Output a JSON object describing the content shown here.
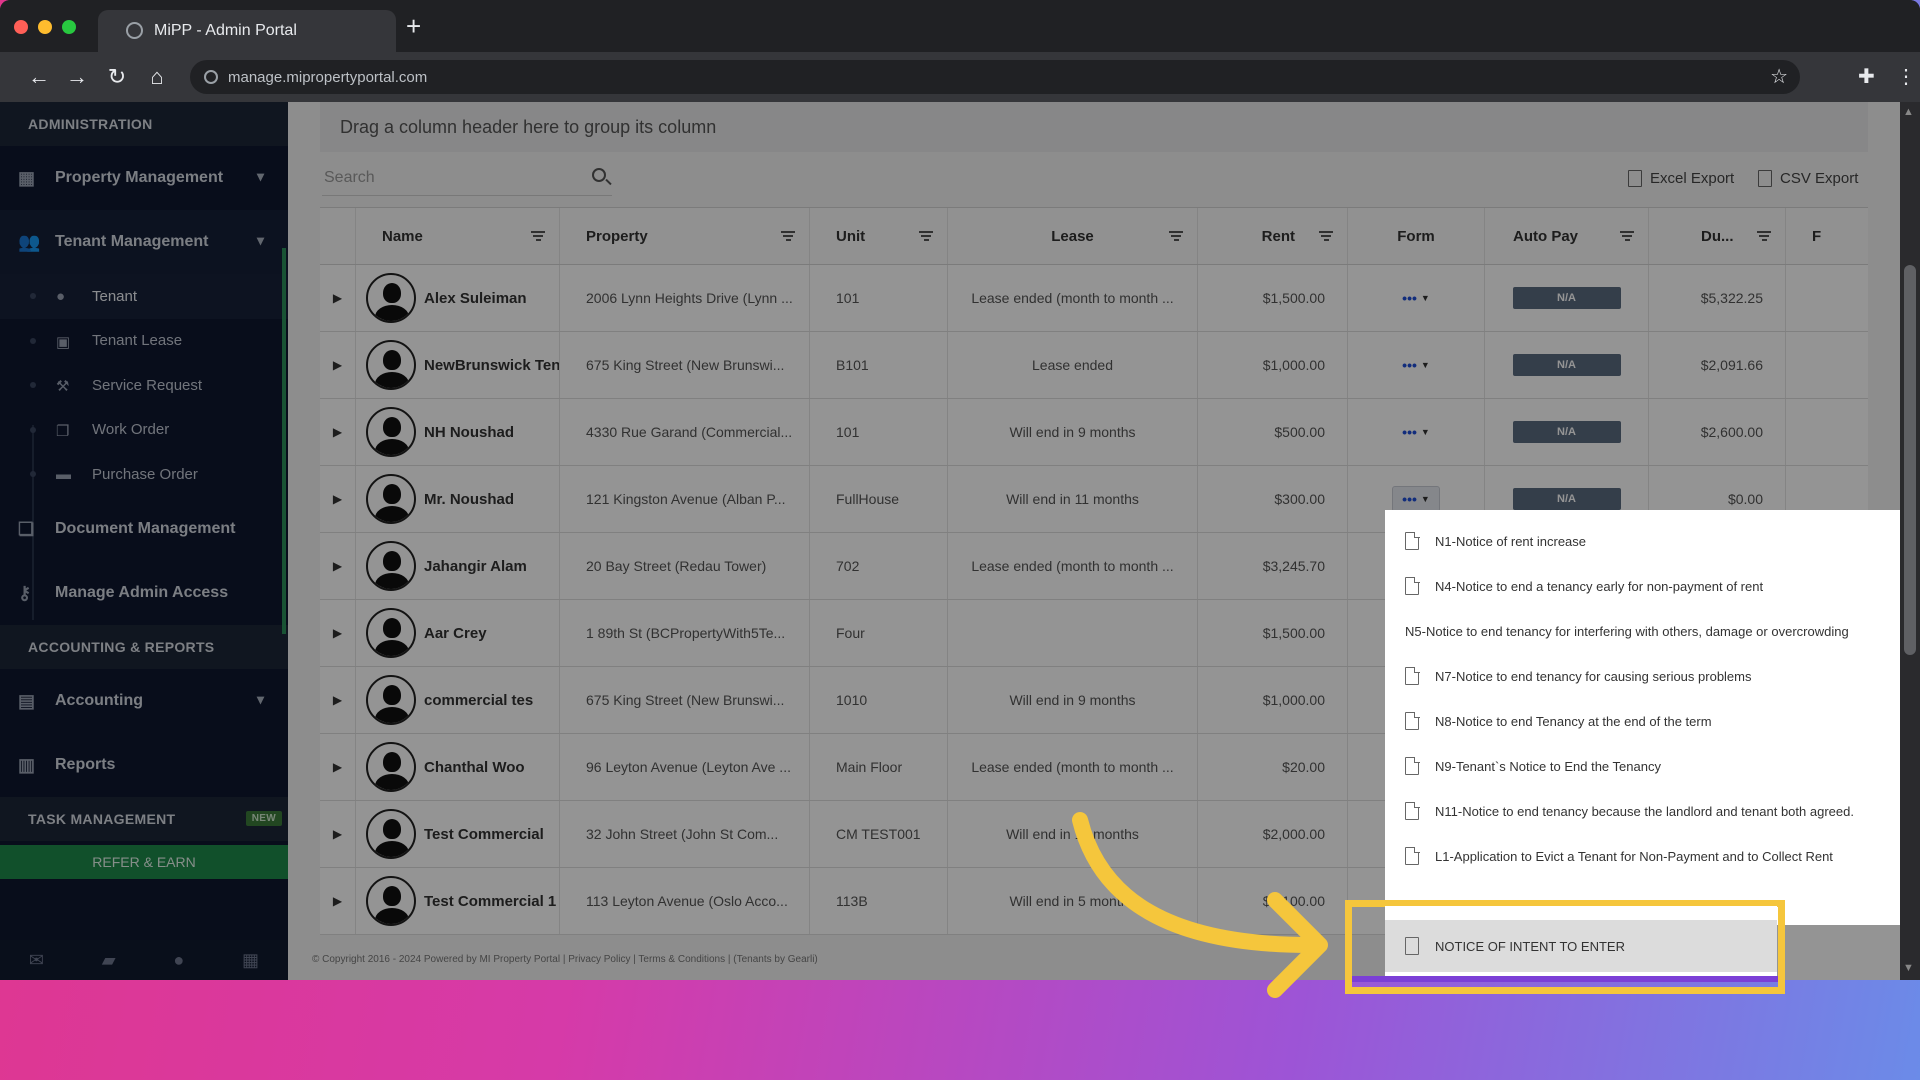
{
  "browser": {
    "tab_title": "MiPP - Admin Portal",
    "new_tab": "+",
    "url": "manage.mipropertyportal.com"
  },
  "sidebar": {
    "section_admin": "ADMINISTRATION",
    "property_management": "Property Management",
    "tenant_management": "Tenant Management",
    "sub_items": [
      {
        "label": "Tenant",
        "icon": "user-icon"
      },
      {
        "label": "Tenant Lease",
        "icon": "calendar-icon"
      },
      {
        "label": "Service Request",
        "icon": "wrench-icon"
      },
      {
        "label": "Work Order",
        "icon": "copy-icon"
      },
      {
        "label": "Purchase Order",
        "icon": "truck-icon"
      }
    ],
    "document_management": "Document Management",
    "manage_admin_access": "Manage Admin Access",
    "section_accounting": "ACCOUNTING & REPORTS",
    "accounting": "Accounting",
    "reports": "Reports",
    "section_task": "TASK MANAGEMENT",
    "new_badge": "NEW",
    "refer": "REFER & EARN"
  },
  "main": {
    "group_hint": "Drag a column header here to group its column",
    "search_placeholder": "Search",
    "excel_export": "Excel Export",
    "csv_export": "CSV Export",
    "columns": [
      "Name",
      "Property",
      "Unit",
      "Lease",
      "Rent",
      "Form",
      "Auto Pay",
      "Du...",
      "F"
    ],
    "rows": [
      {
        "name": "Alex Suleiman",
        "property": "2006 Lynn Heights Drive (Lynn ...",
        "unit": "101",
        "lease": "Lease ended (month to month ...",
        "rent": "$1,500.00",
        "autopay": "N/A",
        "due": "$5,322.25"
      },
      {
        "name": "NewBrunswick Tenant",
        "property": "675 King Street (New Brunswi...",
        "unit": "B101",
        "lease": "Lease ended",
        "rent": "$1,000.00",
        "autopay": "N/A",
        "due": "$2,091.66"
      },
      {
        "name": "NH Noushad",
        "property": "4330 Rue Garand (Commercial...",
        "unit": "101",
        "lease": "Will end in 9 months",
        "rent": "$500.00",
        "autopay": "N/A",
        "due": "$2,600.00"
      },
      {
        "name": "Mr. Noushad",
        "property": "121 Kingston Avenue (Alban P...",
        "unit": "FullHouse",
        "lease": "Will end in 11 months",
        "rent": "$300.00",
        "autopay": "N/A",
        "due": "$0.00"
      },
      {
        "name": "Jahangir Alam",
        "property": "20 Bay Street (Redau Tower)",
        "unit": "702",
        "lease": "Lease ended (month to month ...",
        "rent": "$3,245.70",
        "autopay": "",
        "due": ""
      },
      {
        "name": "Aar Crey",
        "property": "1 89th St (BCPropertyWith5Te...",
        "unit": "Four",
        "lease": "",
        "rent": "$1,500.00",
        "autopay": "",
        "due": ""
      },
      {
        "name": "commercial tes",
        "property": "675 King Street (New Brunswi...",
        "unit": "1010",
        "lease": "Will end in 9 months",
        "rent": "$1,000.00",
        "autopay": "",
        "due": ""
      },
      {
        "name": "Chanthal Woo",
        "property": "96 Leyton Avenue (Leyton Ave ...",
        "unit": "Main Floor",
        "lease": "Lease ended (month to month ...",
        "rent": "$20.00",
        "autopay": "",
        "due": ""
      },
      {
        "name": "Test Commercial",
        "property": "32 John Street (John St Com...",
        "unit": "CM TEST001",
        "lease": "Will end in 11 months",
        "rent": "$2,000.00",
        "autopay": "",
        "due": ""
      },
      {
        "name": "Test Commercial 1",
        "property": "113 Leyton Avenue (Oslo Acco...",
        "unit": "113B",
        "lease": "Will end in 5 months",
        "rent": "$2,100.00",
        "autopay": "",
        "due": ""
      }
    ],
    "form_button": "•••",
    "footer": "© Copyright 2016 - 2024 Powered by MI Property Portal | Privacy Policy | Terms & Conditions | (Tenants by Gearli)"
  },
  "dropdown": {
    "items": [
      {
        "label": "N1-Notice of rent increase",
        "doc": true
      },
      {
        "label": "N4-Notice to end a tenancy early for non-payment of rent",
        "doc": true
      },
      {
        "label": "N5-Notice to end tenancy for interfering with others, damage or overcrowding",
        "doc": false
      },
      {
        "label": "N7-Notice to end tenancy for causing serious problems",
        "doc": true
      },
      {
        "label": "N8-Notice to end Tenancy at the end of the term",
        "doc": true
      },
      {
        "label": "N9-Tenant`s Notice to End the Tenancy",
        "doc": true
      },
      {
        "label": "N11-Notice to end tenancy because the landlord and tenant both agreed.",
        "doc": true
      },
      {
        "label": "L1-Application to Evict a Tenant for Non-Payment and to Collect Rent",
        "doc": true
      }
    ],
    "highlighted": "NOTICE OF INTENT TO ENTER"
  },
  "colors": {
    "highlight": "#f5c63c",
    "sidebar_bg": "#0e1730",
    "accent_green": "#1e8a4a"
  }
}
